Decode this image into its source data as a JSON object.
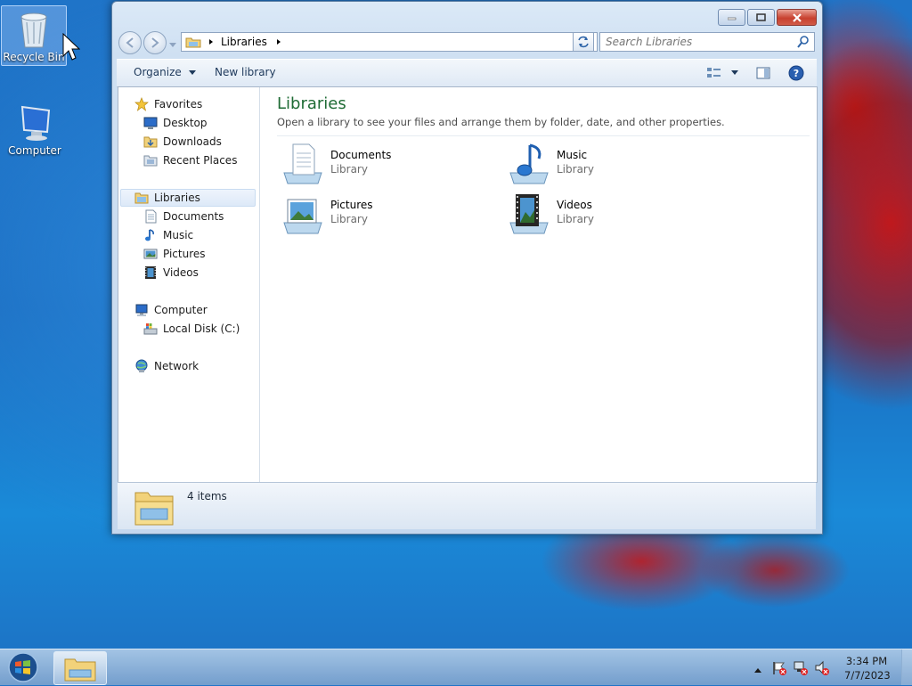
{
  "desktop": {
    "icons": [
      {
        "label": "Recycle Bin",
        "icon": "recycle-bin-icon"
      },
      {
        "label": "Computer",
        "icon": "computer-icon"
      }
    ]
  },
  "window": {
    "controls": {
      "minimize": "minimize-icon",
      "maximize": "maximize-icon",
      "close": "close-icon"
    },
    "address": {
      "crumbs": [
        "Libraries"
      ]
    },
    "search": {
      "placeholder": "Search Libraries"
    },
    "commands": {
      "organize": "Organize",
      "new_library": "New library"
    },
    "nav": {
      "favorites": {
        "label": "Favorites",
        "items": [
          "Desktop",
          "Downloads",
          "Recent Places"
        ]
      },
      "libraries": {
        "label": "Libraries",
        "items": [
          "Documents",
          "Music",
          "Pictures",
          "Videos"
        ]
      },
      "computer": {
        "label": "Computer",
        "items": [
          "Local Disk (C:)"
        ]
      },
      "network": {
        "label": "Network"
      }
    },
    "main": {
      "title": "Libraries",
      "subtitle": "Open a library to see your files and arrange them by folder, date, and other properties.",
      "libraries": [
        {
          "name": "Documents",
          "type": "Library",
          "icon": "documents-library-icon"
        },
        {
          "name": "Music",
          "type": "Library",
          "icon": "music-library-icon"
        },
        {
          "name": "Pictures",
          "type": "Library",
          "icon": "pictures-library-icon"
        },
        {
          "name": "Videos",
          "type": "Library",
          "icon": "videos-library-icon"
        }
      ]
    },
    "details": {
      "count": "4 items"
    }
  },
  "taskbar": {
    "time": "3:34 PM",
    "date": "7/7/2023"
  },
  "colors": {
    "title_green": "#1e6b34",
    "accent_blue": "#1f74c8",
    "close_red": "#c8412f"
  }
}
